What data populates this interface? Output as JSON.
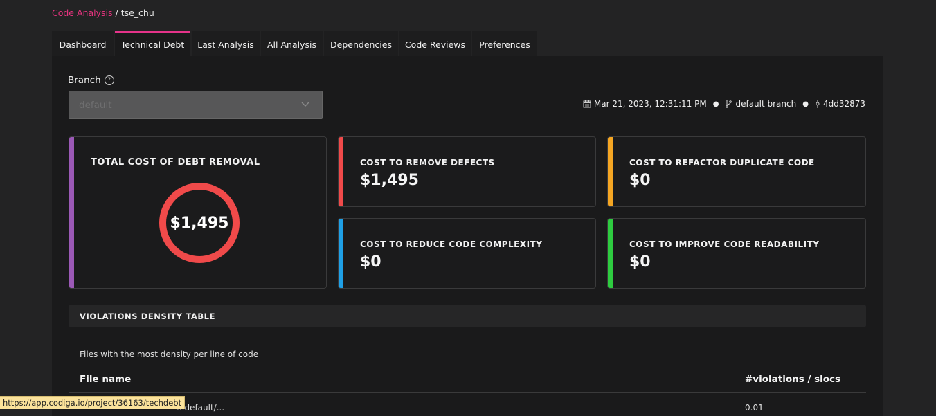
{
  "breadcrumb": {
    "link": "Code Analysis",
    "separator": "/",
    "current": "tse_chu"
  },
  "tabs": [
    {
      "label": "Dashboard"
    },
    {
      "label": "Technical Debt",
      "active": true
    },
    {
      "label": "Last Analysis"
    },
    {
      "label": "All Analysis"
    },
    {
      "label": "Dependencies"
    },
    {
      "label": "Code Reviews"
    },
    {
      "label": "Preferences"
    }
  ],
  "branch": {
    "label": "Branch",
    "selected": "default"
  },
  "meta": {
    "date": "Mar 21, 2023, 12:31:11 PM",
    "branch": "default branch",
    "commit": "4dd32873"
  },
  "total": {
    "title": "TOTAL COST OF DEBT REMOVAL",
    "value": "$1,495",
    "color": "#f04a4a",
    "accent": "#9b59b6"
  },
  "cards": [
    {
      "title": "COST TO REMOVE DEFECTS",
      "value": "$1,495",
      "color": "#f04a4a"
    },
    {
      "title": "COST TO REFACTOR DUPLICATE CODE",
      "value": "$0",
      "color": "#f5a623"
    },
    {
      "title": "COST TO REDUCE CODE COMPLEXITY",
      "value": "$0",
      "color": "#1fa0e6"
    },
    {
      "title": "COST TO IMPROVE CODE READABILITY",
      "value": "$0",
      "color": "#2ecc40"
    }
  ],
  "density": {
    "header": "VIOLATIONS DENSITY TABLE",
    "subtitle": "Files with the most density per line of code",
    "columns": [
      "File name",
      "#violations / slocs"
    ],
    "row_partial": {
      "file": "...default/...",
      "value": "0.01"
    }
  },
  "statusbar": {
    "url": "https://app.codiga.io/project/36163/techdebt"
  }
}
